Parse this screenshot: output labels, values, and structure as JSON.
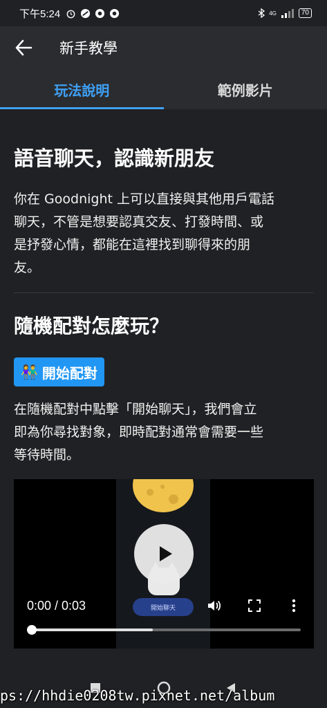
{
  "status_bar": {
    "time": "下午5:24",
    "battery": "70",
    "network": "4G"
  },
  "app_bar": {
    "title": "新手教學"
  },
  "tabs": [
    {
      "label": "玩法說明",
      "active": true
    },
    {
      "label": "範例影片",
      "active": false
    }
  ],
  "intro": {
    "heading": "語音聊天，認識新朋友",
    "lines": [
      "你在 Goodnight 上可以直接與其他用戶電話",
      "聊天，不管是想要認真交友、打發時間、或",
      "是抒發心情，都能在這裡找到聊得來的朋",
      "友。"
    ]
  },
  "random_match": {
    "heading": "隨機配對怎麼玩？",
    "badge_label": "開始配對",
    "badge_icon": "two-people-icon",
    "lines": [
      "在隨機配對中點擊「開始聊天」，我們會立",
      "即為你尋找對象，即時配對通常會需要一些",
      "等待時間。"
    ]
  },
  "video": {
    "time_display": "0:00 / 0:03",
    "progress_fraction": 0.45,
    "buffered_fraction": 0.45,
    "in_video_button": "開始聊天"
  },
  "watermark_url": "ps://hhdie0208tw.pixnet.net/album",
  "colors": {
    "accent": "#3fa1f5",
    "badge": "#2196f3",
    "background": "#202124",
    "bar": "#2b2c2f"
  }
}
